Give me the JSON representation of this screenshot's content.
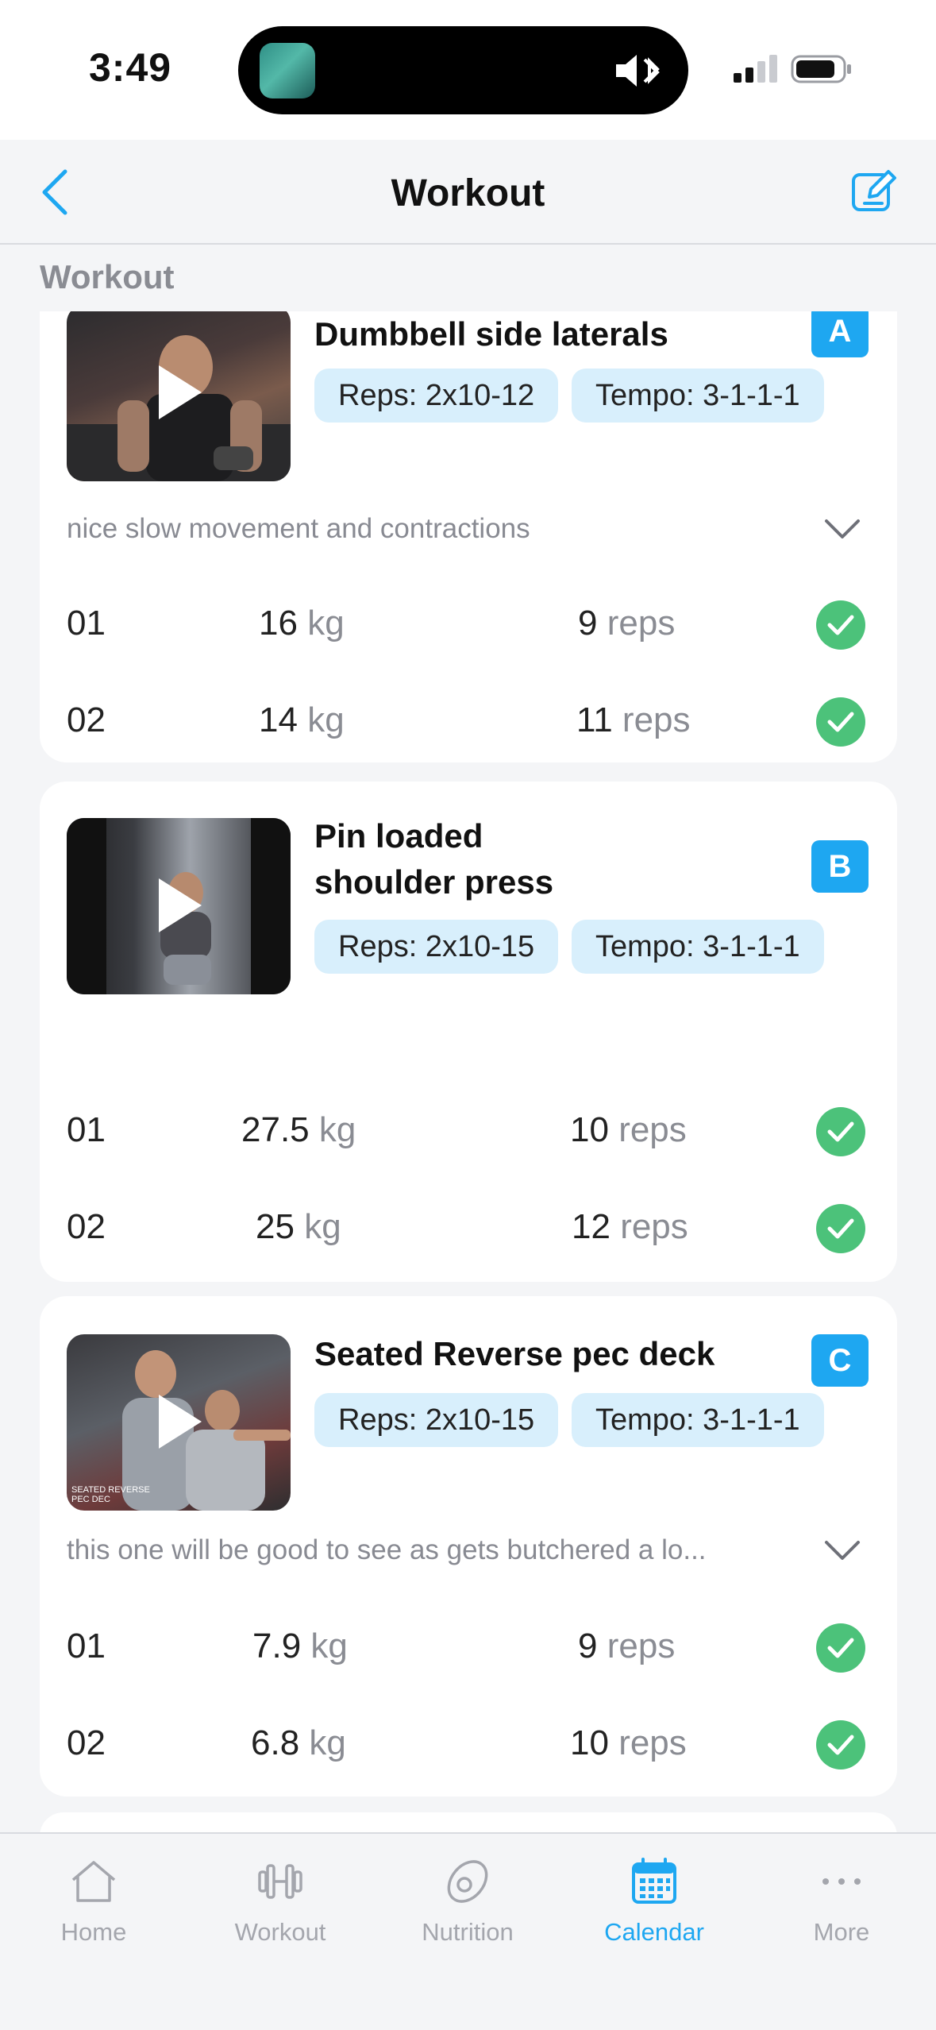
{
  "status": {
    "time": "3:49"
  },
  "nav": {
    "title": "Workout"
  },
  "section": {
    "label": "Workout"
  },
  "exercises": [
    {
      "title": "Dumbbell side laterals",
      "badge": "A",
      "reps": "Reps: 2x10-12",
      "tempo": "Tempo: 3-1-1-1",
      "note": "nice slow movement and contractions",
      "sets": [
        {
          "num": "01",
          "kg": "16",
          "kg_unit": "kg",
          "reps": "9",
          "reps_unit": "reps"
        },
        {
          "num": "02",
          "kg": "14",
          "kg_unit": "kg",
          "reps": "11",
          "reps_unit": "reps"
        }
      ]
    },
    {
      "title": "Pin loaded shoulder press",
      "badge": "B",
      "reps": "Reps: 2x10-15",
      "tempo": "Tempo: 3-1-1-1",
      "note": "",
      "sets": [
        {
          "num": "01",
          "kg": "27.5",
          "kg_unit": "kg",
          "reps": "10",
          "reps_unit": "reps"
        },
        {
          "num": "02",
          "kg": "25",
          "kg_unit": "kg",
          "reps": "12",
          "reps_unit": "reps"
        }
      ]
    },
    {
      "title": "Seated Reverse pec deck",
      "badge": "C",
      "reps": "Reps: 2x10-15",
      "tempo": "Tempo: 3-1-1-1",
      "note": "this one will be good to see as gets butchered a lo...",
      "thumb_caption": "SEATED REVERSE PEC DEC",
      "sets": [
        {
          "num": "01",
          "kg": "7.9",
          "kg_unit": "kg",
          "reps": "9",
          "reps_unit": "reps"
        },
        {
          "num": "02",
          "kg": "6.8",
          "kg_unit": "kg",
          "reps": "10",
          "reps_unit": "reps"
        }
      ]
    }
  ],
  "tabs": [
    {
      "label": "Home",
      "icon": "home-icon"
    },
    {
      "label": "Workout",
      "icon": "dumbbell-icon"
    },
    {
      "label": "Nutrition",
      "icon": "avocado-icon"
    },
    {
      "label": "Calendar",
      "icon": "calendar-icon",
      "active": true
    },
    {
      "label": "More",
      "icon": "more-icon"
    }
  ],
  "colors": {
    "accent": "#1ea7f1",
    "check": "#4cc27a",
    "pill": "#d8effc"
  }
}
